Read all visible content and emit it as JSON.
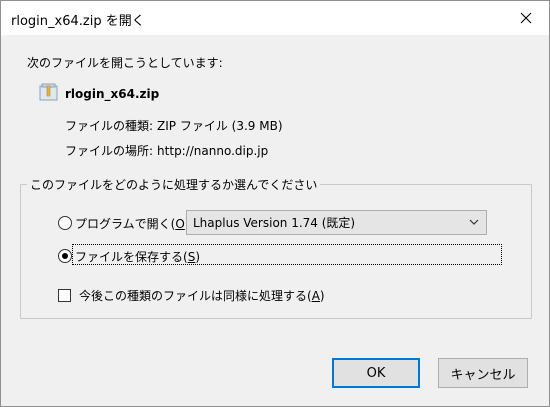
{
  "window": {
    "title": "rlogin_x64.zip を開く",
    "close_glyph": "✕"
  },
  "dialog": {
    "intro_text": "次のファイルを開こうとしています:",
    "file_icon": "zip-archive-icon",
    "filename": "rlogin_x64.zip",
    "type_label": "ファイルの種類:",
    "type_value": "ZIP ファイル (3.9 MB)",
    "location_label": "ファイルの場所:",
    "location_value": "http://nanno.dip.jp"
  },
  "action_group": {
    "legend": "このファイルをどのように処理するか選んでください",
    "open_with": {
      "label_prefix": "プログラムで開く(",
      "accel": "O",
      "label_suffix": "):",
      "selected": false
    },
    "program_select": {
      "value": "Lhaplus Version 1.74 (既定)"
    },
    "save_file": {
      "label_prefix": "ファイルを保存する(",
      "accel": "S",
      "label_suffix": ")",
      "selected": true
    },
    "remember": {
      "label_prefix": "今後この種類のファイルは同様に処理する(",
      "accel": "A",
      "label_suffix": ")",
      "checked": false
    }
  },
  "buttons": {
    "ok": "OK",
    "cancel": "キャンセル"
  },
  "colors": {
    "accent": "#0078d7",
    "dialog_bg": "#f0f0f0",
    "titlebar_bg": "#ffffff"
  }
}
